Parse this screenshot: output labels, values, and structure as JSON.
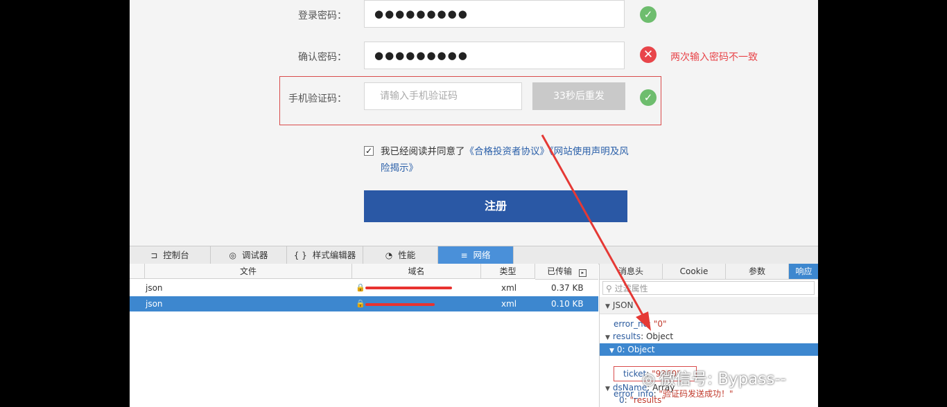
{
  "form": {
    "password_label": "登录密码：",
    "password_value": "●●●●●●●●●",
    "confirm_label": "确认密码：",
    "confirm_value": "●●●●●●●●●",
    "confirm_error": "两次输入密码不一致",
    "sms_label": "手机验证码：",
    "sms_placeholder": "请输入手机验证码",
    "resend_label": "33秒后重发",
    "ok_icon": "✓",
    "error_icon": "✕",
    "agree_prefix": "我已经阅读并同意了",
    "agree_link1": "《合格投资者协议》",
    "agree_link2": "《网站使用声明及风险揭示》",
    "checkbox_mark": "✓",
    "submit_label": "注册"
  },
  "devtools": {
    "tabs": [
      {
        "icon": "⊐",
        "label": "控制台"
      },
      {
        "icon": "◎",
        "label": "调试器"
      },
      {
        "icon": "{ }",
        "label": "样式编辑器"
      },
      {
        "icon": "◔",
        "label": "性能"
      },
      {
        "icon": "≡",
        "label": "网络"
      }
    ],
    "columns": {
      "file": "文件",
      "domain": "域名",
      "type": "类型",
      "size": "已传输"
    },
    "rows": [
      {
        "file": "json",
        "type": "xml",
        "size": "0.37 KB"
      },
      {
        "file": "json",
        "type": "xml",
        "size": "0.10 KB"
      }
    ],
    "side_tabs": [
      "消息头",
      "Cookie",
      "参数",
      "响应"
    ],
    "filter_placeholder": "过滤属性",
    "json_header": "JSON",
    "json": {
      "error_no_key": "error_no",
      "error_no_val": "\"0\"",
      "results_key": "results",
      "results_val": "Object",
      "obj0_label": "0: Object",
      "ticket_key": "ticket",
      "ticket_val": "\"9360\"",
      "dsname_key": "dsName",
      "dsname_val": "Array",
      "ds0_key": "0",
      "ds0_val": "\"results\"",
      "error_info_key": "error_info",
      "error_info_val": "\"验证码发送成功！\""
    }
  },
  "watermark": "微信号: Bypass--",
  "colors": {
    "accent": "#2a58a5",
    "ok": "#6ebd6e",
    "error": "#e8454a",
    "annotation": "#d94b4b"
  }
}
